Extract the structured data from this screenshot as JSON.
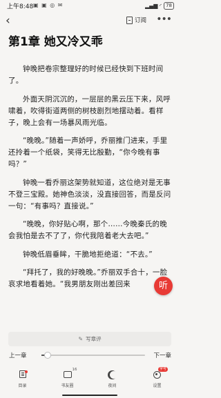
{
  "status_bar": {
    "time": "上午8:48",
    "left_icons": "▣ ▣ ◎ ✉",
    "signal": "▂▄▆ ◜",
    "battery": "78"
  },
  "nav": {
    "back_icon": "‹",
    "subscribe_label": "订阅",
    "more_icon": "•••"
  },
  "chapter": {
    "title": "第1章 她又冷又乖",
    "paragraphs": [
      "钟晚把卷宗整理好的时候已经快到下班时间了。",
      "外面天阴沉沉的，一层层的黑云压下来，风呼啸着，吹得街道两侧的树枝剧烈地摆动着。看样子，晚上会有一场暴风雨光临。",
      "“晚晚。”随着一声娇呼，乔丽推门进来，手里还拎着一个纸袋，笑得无比殷勤，“你今晚有事吗？”",
      "钟晚一看乔丽这架势就知道，这位绝对是无事不登三宝殿。她神色淡淡，没直接回答，而是反问一句：“有事吗？直接说。”",
      "“晚晚，你好贴心啊，那个……今晚秦氏的晚会我怕是去不了了，你代我陪着老大去吧。”",
      "钟晚低眉垂眸，干脆地拒绝道：“不去。”",
      "“拜托了，我的好晚晚。”乔丽双手合十，一脸哀求地看着她。“我男朋友刚出差回来"
    ]
  },
  "listen_button": {
    "label": "听",
    "color": "#e83a35"
  },
  "comment": {
    "icon": "✎",
    "placeholder": "写章评"
  },
  "progress": {
    "prev_label": "上一章",
    "next_label": "下一章",
    "value": 0.06
  },
  "toolbar": {
    "items": [
      {
        "label": "目录",
        "icon": "directory-icon"
      },
      {
        "label": "书友圈",
        "icon": "chat-icon",
        "count": "16"
      },
      {
        "label": "夜间",
        "icon": "moon-icon"
      },
      {
        "label": "设置",
        "icon": "gear-icon",
        "badge": "字号"
      }
    ]
  },
  "colors": {
    "background": "#f6f5f3",
    "accent": "#e83a35",
    "text": "#1f1f1f"
  }
}
